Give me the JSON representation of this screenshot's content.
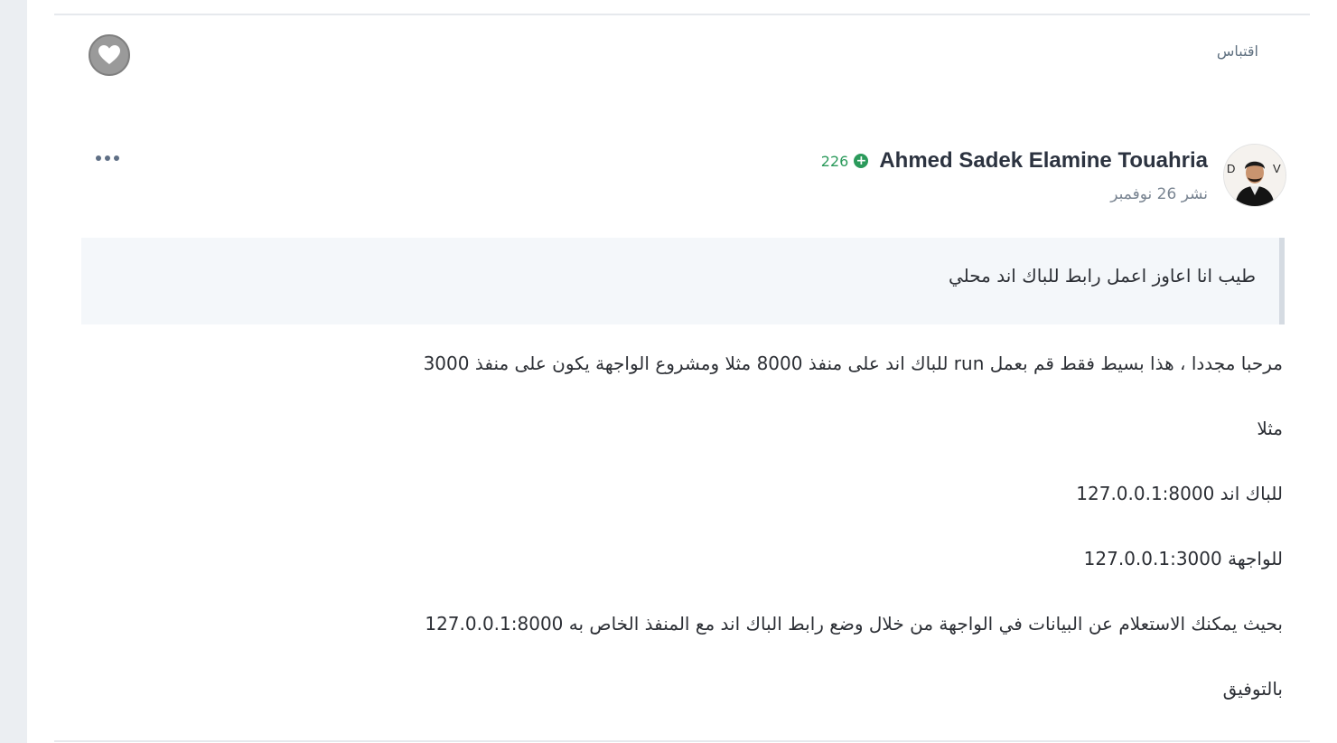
{
  "post": {
    "quote_action": "اقتباس",
    "author": {
      "name": "Ahmed Sadek Elamine Touahria",
      "reputation": "226",
      "avatar_badge_left": "D",
      "avatar_badge_right": "V"
    },
    "posted": "نشر 26 نوفمبر",
    "quoted_text": "طيب انا اعاوز اعمل رابط للباك اند محلي",
    "paragraphs": [
      "مرحبا مجددا ، هذا بسيط فقط قم بعمل run للباك اند على منفذ 8000 مثلا ومشروع الواجهة يكون على منفذ 3000",
      "مثلا",
      "للباك اند 127.0.0.1:8000",
      "للواجهة 127.0.0.1:3000",
      "بحيث يمكنك الاستعلام عن البيانات في الواجهة من خلال وضع رابط الباك اند مع المنفذ الخاص به 127.0.0.1:8000",
      "بالتوفيق"
    ]
  },
  "colors": {
    "reputation_green": "#2b9a5b",
    "quote_bg": "#f4f7fa",
    "like_gray": "#9a9a9a"
  },
  "icons": {
    "like": "heart-icon",
    "more": "ellipsis-icon",
    "reputation": "plus-circle-icon"
  }
}
